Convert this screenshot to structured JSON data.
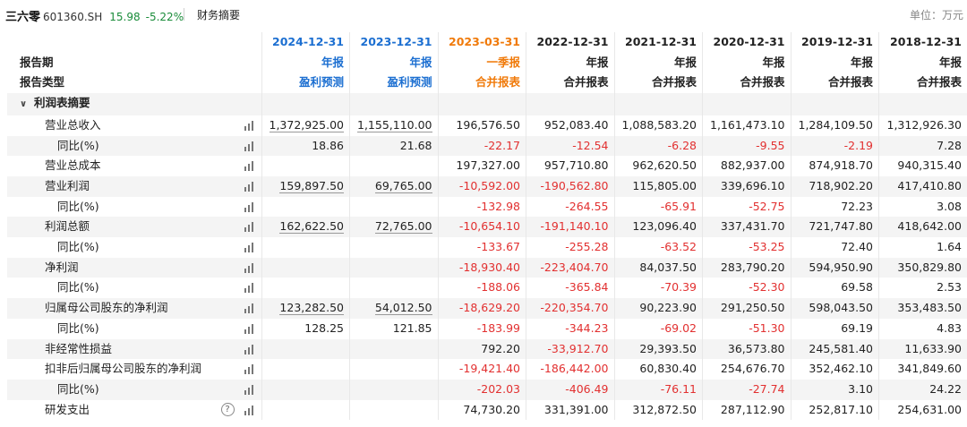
{
  "topbar": {
    "stock_name": "三六零",
    "stock_code": "601360.SH",
    "price": "15.98",
    "change": "-5.22%",
    "tab": "财务摘要",
    "unit": "单位：万元"
  },
  "header": {
    "row_labels": [
      "报告期",
      "报告类型"
    ],
    "columns": [
      {
        "date": "2024-12-31",
        "period": "年报",
        "type": "盈利预测",
        "color": "#1c6fd1"
      },
      {
        "date": "2023-12-31",
        "period": "年报",
        "type": "盈利预测",
        "color": "#1c6fd1"
      },
      {
        "date": "2023-03-31",
        "period": "一季报",
        "type": "合并报表",
        "color": "#f07a0a"
      },
      {
        "date": "2022-12-31",
        "period": "年报",
        "type": "合并报表",
        "color": "#222222"
      },
      {
        "date": "2021-12-31",
        "period": "年报",
        "type": "合并报表",
        "color": "#222222"
      },
      {
        "date": "2020-12-31",
        "period": "年报",
        "type": "合并报表",
        "color": "#222222"
      },
      {
        "date": "2019-12-31",
        "period": "年报",
        "type": "合并报表",
        "color": "#222222"
      },
      {
        "date": "2018-12-31",
        "period": "年报",
        "type": "合并报表",
        "color": "#222222"
      }
    ]
  },
  "section": {
    "label": "利润表摘要"
  },
  "rows": [
    {
      "label": "营业总收入",
      "sub": false,
      "values": [
        "1,372,925.00",
        "1,155,110.00",
        "196,576.50",
        "952,083.40",
        "1,088,583.20",
        "1,161,473.10",
        "1,284,109.50",
        "1,312,926.30"
      ]
    },
    {
      "label": "同比(%)",
      "sub": true,
      "values": [
        "18.86",
        "21.68",
        "-22.17",
        "-12.54",
        "-6.28",
        "-9.55",
        "-2.19",
        "7.28"
      ]
    },
    {
      "label": "营业总成本",
      "sub": false,
      "values": [
        "",
        "",
        "197,327.00",
        "957,710.80",
        "962,620.50",
        "882,937.00",
        "874,918.70",
        "940,315.40"
      ]
    },
    {
      "label": "营业利润",
      "sub": false,
      "values": [
        "159,897.50",
        "69,765.00",
        "-10,592.00",
        "-190,562.80",
        "115,805.00",
        "339,696.10",
        "718,902.20",
        "417,410.80"
      ]
    },
    {
      "label": "同比(%)",
      "sub": true,
      "values": [
        "",
        "",
        "-132.98",
        "-264.55",
        "-65.91",
        "-52.75",
        "72.23",
        "3.08"
      ]
    },
    {
      "label": "利润总额",
      "sub": false,
      "values": [
        "162,622.50",
        "72,765.00",
        "-10,654.10",
        "-191,140.10",
        "123,096.40",
        "337,431.70",
        "721,747.80",
        "418,642.00"
      ]
    },
    {
      "label": "同比(%)",
      "sub": true,
      "values": [
        "",
        "",
        "-133.67",
        "-255.28",
        "-63.52",
        "-53.25",
        "72.40",
        "1.64"
      ]
    },
    {
      "label": "净利润",
      "sub": false,
      "values": [
        "",
        "",
        "-18,930.40",
        "-223,404.70",
        "84,037.50",
        "283,790.20",
        "594,950.90",
        "350,829.80"
      ]
    },
    {
      "label": "同比(%)",
      "sub": true,
      "values": [
        "",
        "",
        "-188.06",
        "-365.84",
        "-70.39",
        "-52.30",
        "69.58",
        "2.53"
      ]
    },
    {
      "label": "归属母公司股东的净利润",
      "sub": false,
      "values": [
        "123,282.50",
        "54,012.50",
        "-18,629.20",
        "-220,354.70",
        "90,223.90",
        "291,250.50",
        "598,043.50",
        "353,483.50"
      ]
    },
    {
      "label": "同比(%)",
      "sub": true,
      "values": [
        "128.25",
        "121.85",
        "-183.99",
        "-344.23",
        "-69.02",
        "-51.30",
        "69.19",
        "4.83"
      ]
    },
    {
      "label": "非经常性损益",
      "sub": false,
      "values": [
        "",
        "",
        "792.20",
        "-33,912.70",
        "29,393.50",
        "36,573.80",
        "245,581.40",
        "11,633.90"
      ]
    },
    {
      "label": "扣非后归属母公司股东的净利润",
      "sub": false,
      "values": [
        "",
        "",
        "-19,421.40",
        "-186,442.00",
        "60,830.40",
        "254,676.70",
        "352,462.10",
        "341,849.60"
      ]
    },
    {
      "label": "同比(%)",
      "sub": true,
      "values": [
        "",
        "",
        "-202.03",
        "-406.49",
        "-76.11",
        "-27.74",
        "3.10",
        "24.22"
      ]
    },
    {
      "label": "研发支出",
      "sub": false,
      "help": true,
      "values": [
        "",
        "",
        "74,730.20",
        "331,391.00",
        "312,872.50",
        "287,112.90",
        "252,817.10",
        "254,631.00"
      ]
    }
  ],
  "colors": {
    "negative": "#e23030",
    "forecast": "#1c6fd1",
    "quarter": "#f07a0a",
    "gain": "#1a8c3a"
  }
}
